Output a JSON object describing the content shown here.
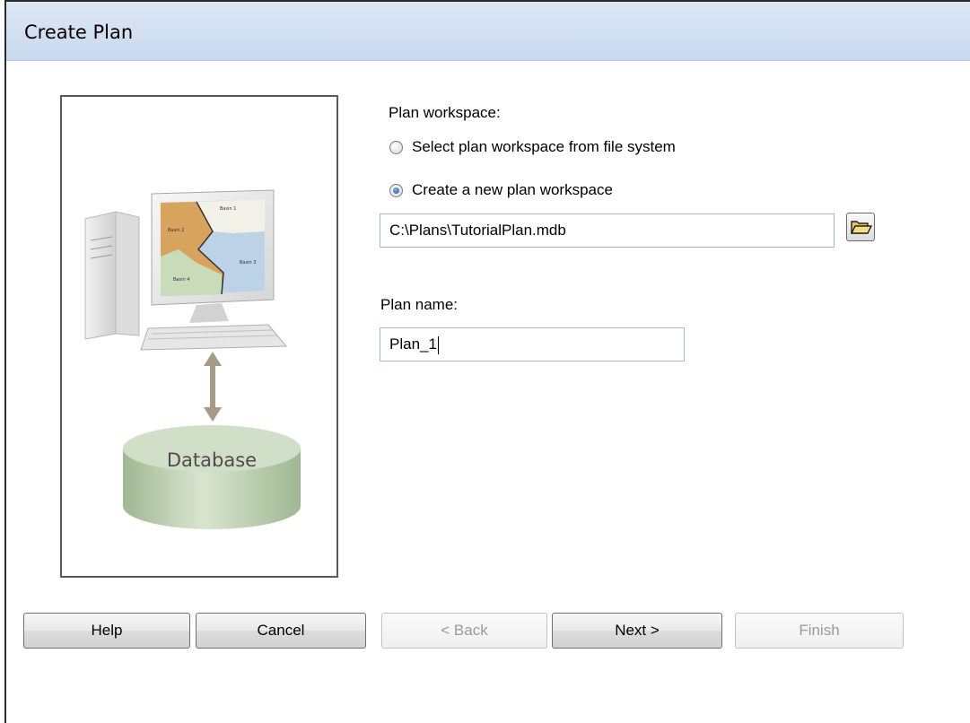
{
  "window": {
    "title": "Create Plan"
  },
  "illustration": {
    "database_label": "Database",
    "map_labels": [
      "Basin 1",
      "Basin 2",
      "Basin 3",
      "Basin 4"
    ]
  },
  "workspace": {
    "heading": "Plan workspace:",
    "option_select": "Select plan workspace from file system",
    "option_create": "Create a new plan workspace",
    "selected_option": "Create a new plan workspace",
    "path": "C:\\Plans\\TutorialPlan.mdb"
  },
  "plan": {
    "heading": "Plan name:",
    "name": "Plan_1"
  },
  "buttons": {
    "help": "Help",
    "cancel": "Cancel",
    "back": "< Back",
    "next": "Next >",
    "finish": "Finish"
  },
  "icons": {
    "browse": "folder-open-icon"
  }
}
